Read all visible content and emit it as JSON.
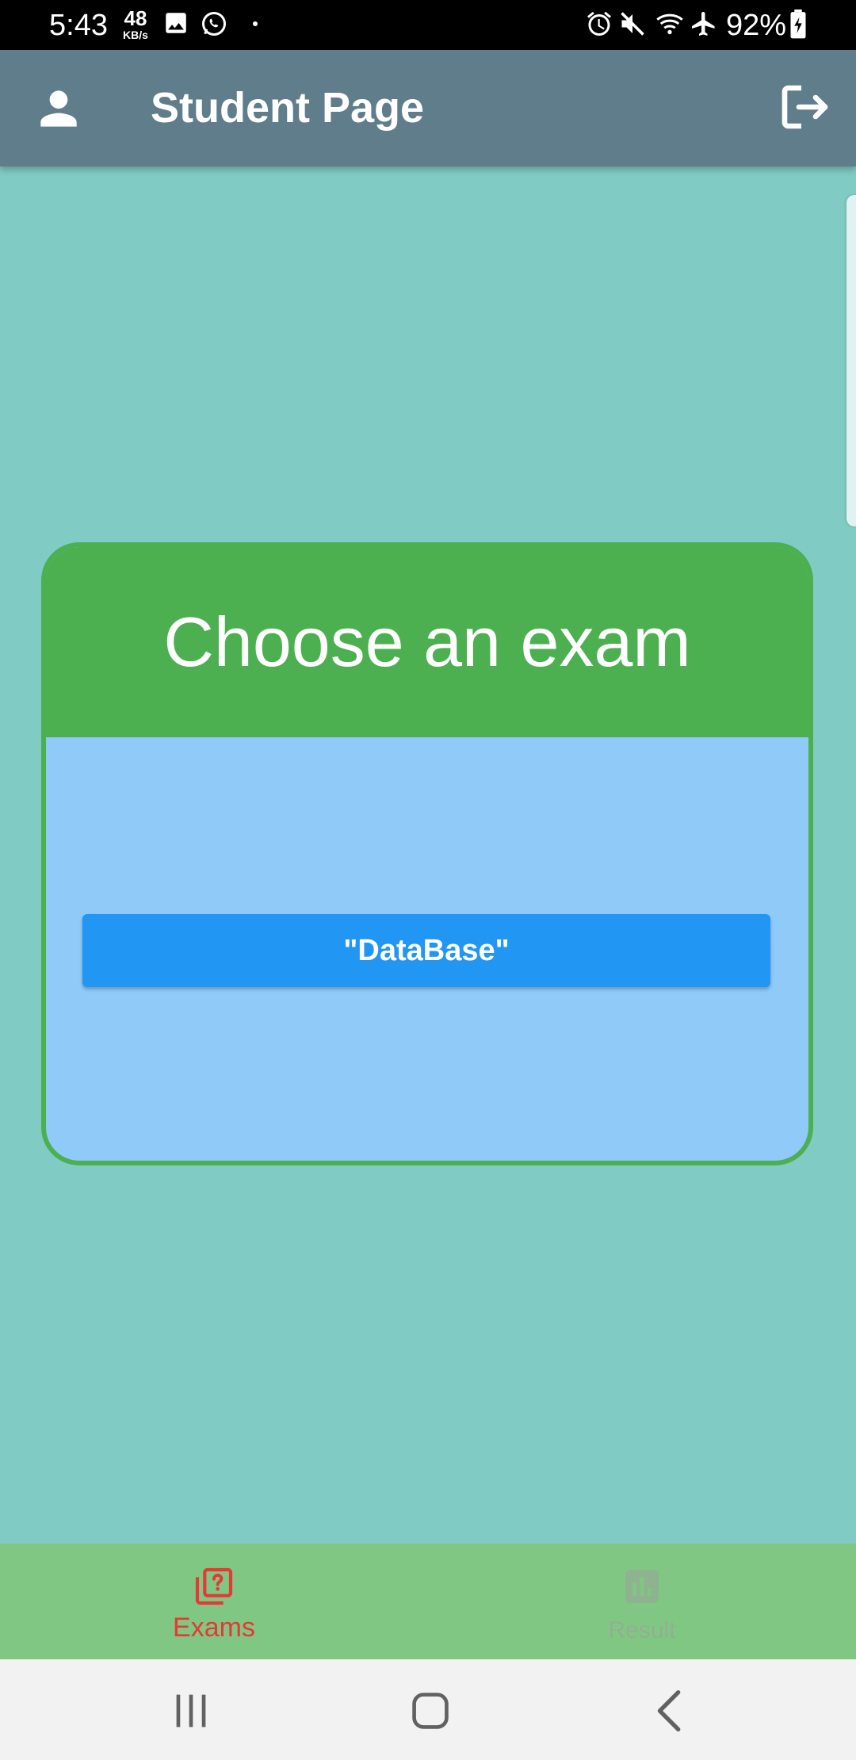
{
  "status_bar": {
    "time": "5:43",
    "net_speed_value": "48",
    "net_speed_unit": "KB/s",
    "battery_percent": "92%",
    "left_icons": [
      "image-icon",
      "whatsapp-icon",
      "dot-icon"
    ],
    "right_icons": [
      "alarm-icon",
      "mute-icon",
      "wifi-icon",
      "airplane-icon",
      "battery-icon"
    ]
  },
  "app_bar": {
    "title": "Student Page",
    "left_icon": "person-icon",
    "right_icon": "logout-icon",
    "background": "#607d8b"
  },
  "card": {
    "heading": "Choose an exam",
    "exams": [
      "\"DataBase\""
    ],
    "header_color": "#4caf50",
    "body_color": "#90caf9",
    "button_color": "#2196f3"
  },
  "bottom_nav": {
    "items": [
      {
        "label": "Exams",
        "icon": "quiz-icon",
        "active": true,
        "color": "#e53935"
      },
      {
        "label": "Result",
        "icon": "bar-chart-icon",
        "active": false,
        "color": "#9e9e9e"
      }
    ],
    "background": "#81c784"
  },
  "system_nav": {
    "buttons": [
      "recents-icon",
      "home-icon",
      "back-icon"
    ]
  },
  "colors": {
    "page_background": "#80cbc4"
  }
}
